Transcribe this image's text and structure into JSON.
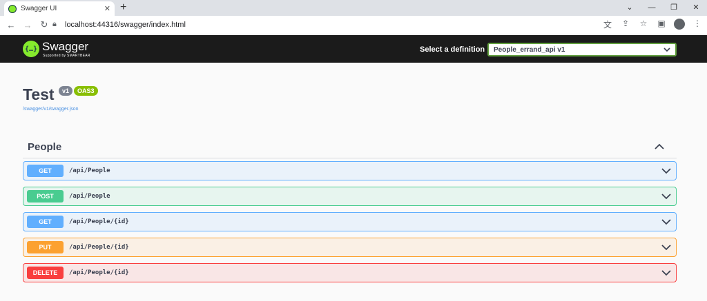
{
  "browser": {
    "tab_title": "Swagger UI",
    "url": "localhost:44316/swagger/index.html"
  },
  "topbar": {
    "logo_text": "Swagger",
    "logo_sub": "Supported by SMARTBEAR",
    "definition_label": "Select a definition",
    "definition_value": "People_errand_api v1"
  },
  "info": {
    "title": "Test",
    "version": "v1",
    "oas": "OAS3",
    "link": "/swagger/v1/swagger.json"
  },
  "section": {
    "title": "People"
  },
  "operations": [
    {
      "method": "GET",
      "path": "/api/People"
    },
    {
      "method": "POST",
      "path": "/api/People"
    },
    {
      "method": "GET",
      "path": "/api/People/{id}"
    },
    {
      "method": "PUT",
      "path": "/api/People/{id}"
    },
    {
      "method": "DELETE",
      "path": "/api/People/{id}"
    }
  ]
}
